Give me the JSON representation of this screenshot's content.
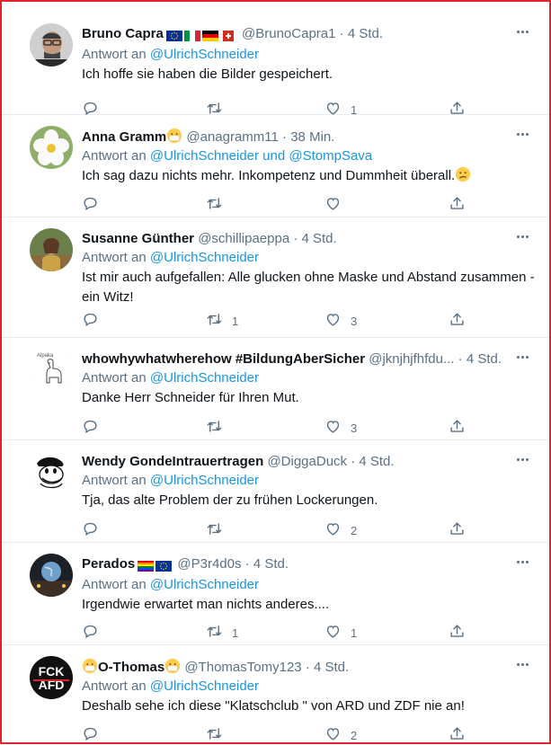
{
  "reply_prefix": "Antwort an",
  "tweets": [
    {
      "name": "Bruno Capra",
      "handle": "@BrunoCapra1",
      "sep": "·",
      "time": "4 Std.",
      "reply_to": "@UlrichSchneider",
      "text": "Ich hoffe sie haben die Bilder gespeichert.",
      "replies": "",
      "retweets": "",
      "likes": "1",
      "flags": [
        "eu",
        "it",
        "de",
        "ch"
      ],
      "avatar": "man-glasses"
    },
    {
      "name": "Anna Gramm",
      "handle": "@anagramm11",
      "sep": "·",
      "time": "38 Min.",
      "reply_to": "@UlrichSchneider und @StompSava",
      "text": "Ich sag dazu nichts mehr. Inkompetenz und Dummheit überall.",
      "replies": "",
      "retweets": "",
      "likes": "",
      "flags": [],
      "name_emoji": "mask-face",
      "text_emoji": "confused-face",
      "avatar": "white-flower"
    },
    {
      "name": "Susanne Günther",
      "handle": "@schillipaeppa",
      "sep": "·",
      "time": "4 Std.",
      "reply_to": "@UlrichSchneider",
      "text": "Ist mir auch aufgefallen: Alle glucken ohne Maske und Abstand zusammen - ein Witz!",
      "replies": "",
      "retweets": "1",
      "likes": "3",
      "flags": [],
      "avatar": "woman-photo"
    },
    {
      "name": "whowhywhatwherehow #BildungAberSicher",
      "handle": "@jknjhjfhfdu...",
      "sep": "·",
      "time": "4 Std.",
      "reply_to": "@UlrichSchneider",
      "text": "Danke Herr Schneider für Ihren Mut.",
      "replies": "",
      "retweets": "",
      "likes": "3",
      "flags": [],
      "avatar": "alpaka-drawing",
      "avatar_label": "Alpaka"
    },
    {
      "name": "Wendy GondeIntrauertragen",
      "handle": "@DiggaDuck",
      "sep": "·",
      "time": "4 Std.",
      "reply_to": "@UlrichSchneider",
      "text": "Tja, das alte Problem der zu frühen Lockerungen.",
      "replies": "",
      "retweets": "",
      "likes": "2",
      "flags": [],
      "avatar": "duck-cartoon"
    },
    {
      "name": "Perados",
      "handle": "@P3r4d0s",
      "sep": "·",
      "time": "4 Std.",
      "reply_to": "@UlrichSchneider",
      "text": "Irgendwie erwartet man nichts anderes....",
      "replies": "",
      "retweets": "1",
      "likes": "1",
      "flags": [
        "rainbow",
        "eu"
      ],
      "avatar": "globe-night"
    },
    {
      "name": "O-Thomas",
      "handle": "@ThomasTomy123",
      "sep": "·",
      "time": "4 Std.",
      "reply_to": "@UlrichSchneider",
      "text": "Deshalb  sehe  ich diese \"Klatschclub \" von ARD und ZDF nie an!",
      "replies": "",
      "retweets": "",
      "likes": "2",
      "flags": [],
      "name_emoji": "mask-face",
      "avatar": "fck-afd",
      "avatar_label_1": "FCK",
      "avatar_label_2": "AFD"
    }
  ],
  "colors": {
    "link": "#1b95e0",
    "muted": "#5b7083",
    "text": "#0f1419",
    "frame": "#e0242e"
  }
}
